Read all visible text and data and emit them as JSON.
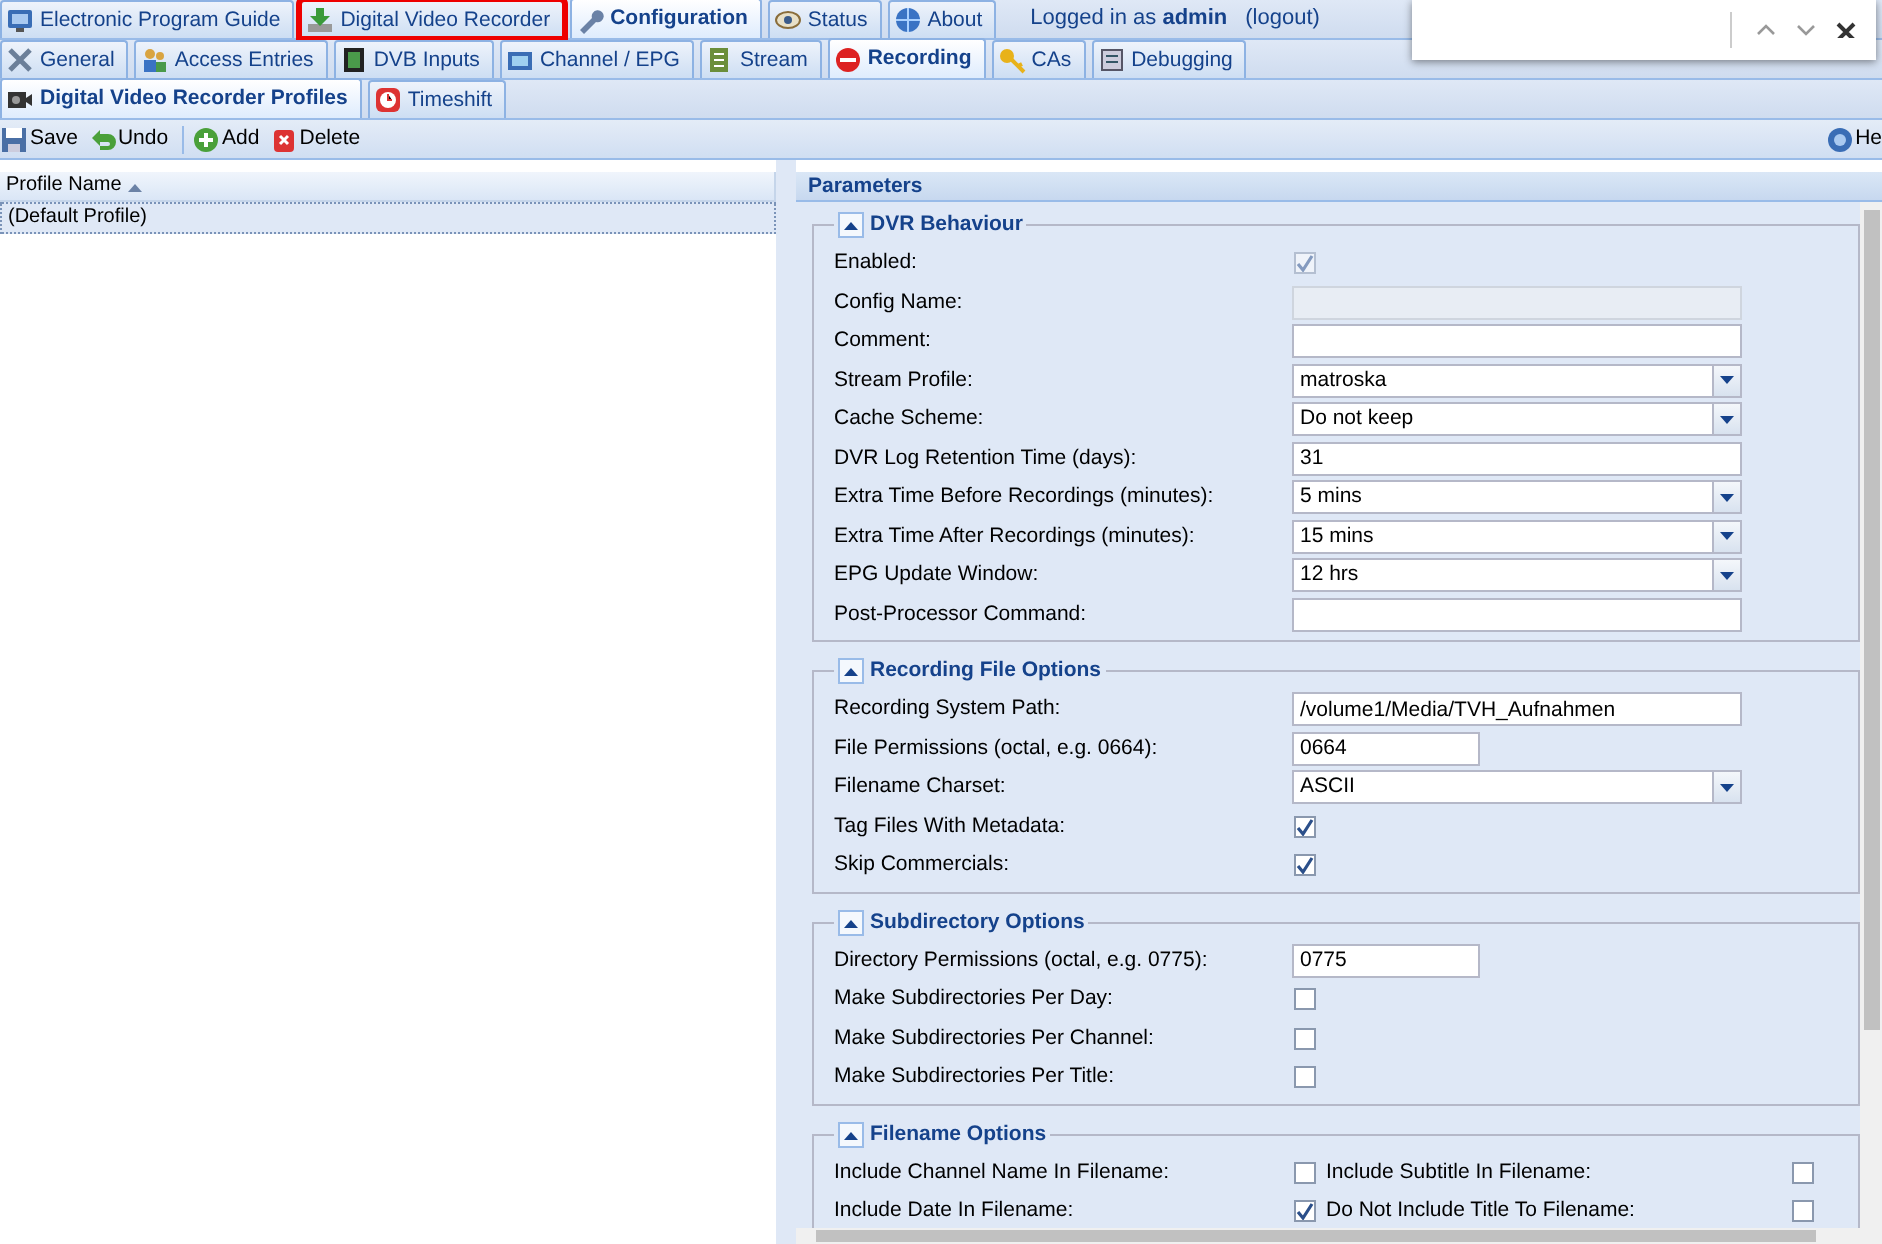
{
  "top_tabs": [
    {
      "label": "Electronic Program Guide",
      "selected": false,
      "highlighted": false
    },
    {
      "label": "Digital Video Recorder",
      "selected": false,
      "highlighted": true
    },
    {
      "label": "Configuration",
      "selected": true,
      "highlighted": false
    },
    {
      "label": "Status",
      "selected": false,
      "highlighted": false
    },
    {
      "label": "About",
      "selected": false,
      "highlighted": false
    }
  ],
  "login": {
    "text": "Logged in as **admin**",
    "logout": "(logout)"
  },
  "config_tabs": [
    {
      "label": "General",
      "selected": false
    },
    {
      "label": "Access Entries",
      "selected": false
    },
    {
      "label": "DVB Inputs",
      "selected": false
    },
    {
      "label": "Channel / EPG",
      "selected": false
    },
    {
      "label": "Stream",
      "selected": false
    },
    {
      "label": "Recording",
      "selected": true
    },
    {
      "label": "CAs",
      "selected": false
    },
    {
      "label": "Debugging",
      "selected": false
    }
  ],
  "sub_tabs": [
    {
      "label": "Digital Video Recorder Profiles",
      "selected": true
    },
    {
      "label": "Timeshift",
      "selected": false
    }
  ],
  "toolbar": [
    {
      "label": "Save",
      "kind": "save"
    },
    {
      "label": "Undo",
      "kind": "undo"
    },
    {
      "label": "Add",
      "kind": "add"
    },
    {
      "label": "Delete",
      "kind": "delete"
    }
  ],
  "help": "He",
  "profiles": {
    "column": "Profile Name",
    "rows": [
      {
        "name": "(Default Profile)",
        "selected": true
      }
    ]
  },
  "parameters": {
    "title": "Parameters",
    "sections": [
      {
        "title": "DVR Behaviour",
        "expanded": true,
        "fields": [
          {
            "label": "Enabled:",
            "kind": "checkbox",
            "checked": true,
            "disabled": true
          },
          {
            "label": "Config Name:",
            "kind": "text",
            "disabled": true
          },
          {
            "label": "Comment:",
            "kind": "text",
            "disabled": false
          },
          {
            "label": "Stream Profile:",
            "kind": "select",
            "value": "matroska"
          },
          {
            "label": "Cache Scheme:",
            "kind": "select",
            "value": "Do not keep"
          },
          {
            "label": "DVR Log Retention Time (days):",
            "kind": "text",
            "value": "31",
            "disabled": false
          },
          {
            "label": "Extra Time Before Recordings (minutes):",
            "kind": "select",
            "value": "5 mins"
          },
          {
            "label": "Extra Time After Recordings (minutes):",
            "kind": "select",
            "value": "15 mins"
          },
          {
            "label": "EPG Update Window:",
            "kind": "select",
            "value": "12 hrs"
          },
          {
            "label": "Post-Processor Command:",
            "kind": "text",
            "disabled": false
          }
        ]
      },
      {
        "title": "Recording File Options",
        "expanded": true,
        "fields": [
          {
            "label": "Recording System Path:",
            "kind": "text",
            "value": "/volume1/Media/TVH_Aufnahmen",
            "disabled": false
          },
          {
            "label": "File Permissions (octal, e.g. 0664):",
            "kind": "short_text",
            "value": "0664"
          },
          {
            "label": "Filename Charset:",
            "kind": "select",
            "value": "ASCII"
          },
          {
            "label": "Tag Files With Metadata:",
            "kind": "checkbox",
            "checked": true,
            "disabled": false
          },
          {
            "label": "Skip Commercials:",
            "kind": "checkbox",
            "checked": true,
            "disabled": false
          }
        ]
      },
      {
        "title": "Subdirectory Options",
        "expanded": true,
        "fields": [
          {
            "label": "Directory Permissions (octal, e.g. 0775):",
            "kind": "short_text",
            "value": "0775"
          },
          {
            "label": "Make Subdirectories Per Day:",
            "kind": "checkbox",
            "checked": false,
            "disabled": false
          },
          {
            "label": "Make Subdirectories Per Channel:",
            "kind": "checkbox",
            "checked": false,
            "disabled": false
          },
          {
            "label": "Make Subdirectories Per Title:",
            "kind": "checkbox",
            "checked": false,
            "disabled": false
          }
        ]
      },
      {
        "title": "Filename Options",
        "expanded": true,
        "fields": [
          {
            "kind": "pair",
            "left": {
              "label": "Include Channel Name In Filename:",
              "checked": false
            },
            "right": {
              "label": "Include Subtitle In Filename:",
              "checked": false
            }
          },
          {
            "kind": "pair",
            "left": {
              "label": "Include Date In Filename:",
              "checked": true
            },
            "right": {
              "label": "Do Not Include Title To Filename:",
              "checked": false
            }
          }
        ]
      }
    ]
  }
}
